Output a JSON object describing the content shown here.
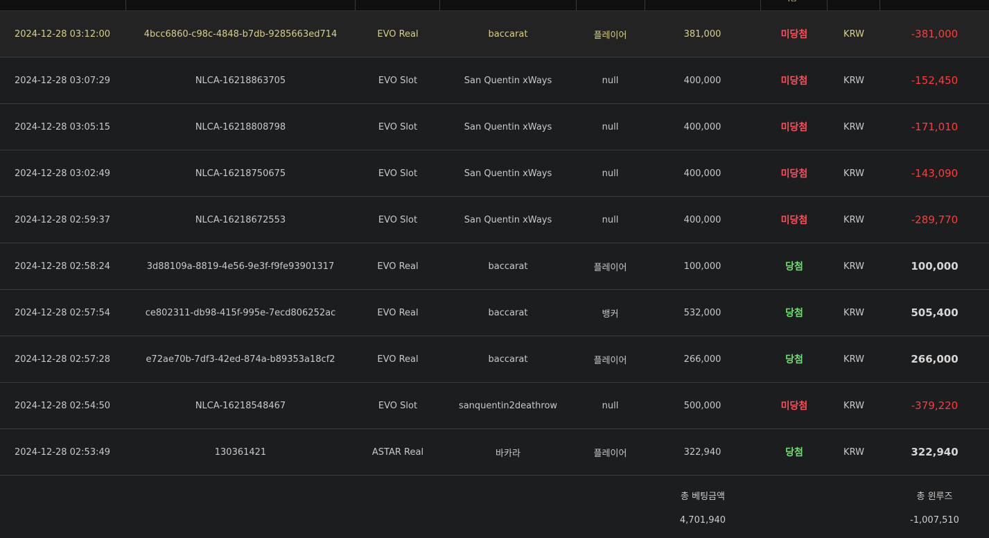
{
  "header": {
    "partial_label": "적중"
  },
  "rows": [
    {
      "date": "2024-12-28 03:12:00",
      "bet_id": "4bcc6860-c98c-4848-b7db-9285663ed714",
      "vendor": "EVO Real",
      "game": "baccarat",
      "pick": "플레이어",
      "bet": "381,000",
      "result": "미당첨",
      "currency": "KRW",
      "winloss": "-381,000",
      "status": "lose"
    },
    {
      "date": "2024-12-28 03:07:29",
      "bet_id": "NLCA-16218863705",
      "vendor": "EVO Slot",
      "game": "San Quentin xWays",
      "pick": "null",
      "bet": "400,000",
      "result": "미당첨",
      "currency": "KRW",
      "winloss": "-152,450",
      "status": "lose"
    },
    {
      "date": "2024-12-28 03:05:15",
      "bet_id": "NLCA-16218808798",
      "vendor": "EVO Slot",
      "game": "San Quentin xWays",
      "pick": "null",
      "bet": "400,000",
      "result": "미당첨",
      "currency": "KRW",
      "winloss": "-171,010",
      "status": "lose"
    },
    {
      "date": "2024-12-28 03:02:49",
      "bet_id": "NLCA-16218750675",
      "vendor": "EVO Slot",
      "game": "San Quentin xWays",
      "pick": "null",
      "bet": "400,000",
      "result": "미당첨",
      "currency": "KRW",
      "winloss": "-143,090",
      "status": "lose"
    },
    {
      "date": "2024-12-28 02:59:37",
      "bet_id": "NLCA-16218672553",
      "vendor": "EVO Slot",
      "game": "San Quentin xWays",
      "pick": "null",
      "bet": "400,000",
      "result": "미당첨",
      "currency": "KRW",
      "winloss": "-289,770",
      "status": "lose"
    },
    {
      "date": "2024-12-28 02:58:24",
      "bet_id": "3d88109a-8819-4e56-9e3f-f9fe93901317",
      "vendor": "EVO Real",
      "game": "baccarat",
      "pick": "플레이어",
      "bet": "100,000",
      "result": "당첨",
      "currency": "KRW",
      "winloss": "100,000",
      "status": "win"
    },
    {
      "date": "2024-12-28 02:57:54",
      "bet_id": "ce802311-db98-415f-995e-7ecd806252ac",
      "vendor": "EVO Real",
      "game": "baccarat",
      "pick": "뱅커",
      "bet": "532,000",
      "result": "당첨",
      "currency": "KRW",
      "winloss": "505,400",
      "status": "win"
    },
    {
      "date": "2024-12-28 02:57:28",
      "bet_id": "e72ae70b-7df3-42ed-874a-b89353a18cf2",
      "vendor": "EVO Real",
      "game": "baccarat",
      "pick": "플레이어",
      "bet": "266,000",
      "result": "당첨",
      "currency": "KRW",
      "winloss": "266,000",
      "status": "win"
    },
    {
      "date": "2024-12-28 02:54:50",
      "bet_id": "NLCA-16218548467",
      "vendor": "EVO Slot",
      "game": "sanquentin2deathrow",
      "pick": "null",
      "bet": "500,000",
      "result": "미당첨",
      "currency": "KRW",
      "winloss": "-379,220",
      "status": "lose"
    },
    {
      "date": "2024-12-28 02:53:49",
      "bet_id": "130361421",
      "vendor": "ASTAR Real",
      "game": "바카라",
      "pick": "플레이어",
      "bet": "322,940",
      "result": "당첨",
      "currency": "KRW",
      "winloss": "322,940",
      "status": "win"
    }
  ],
  "summary": {
    "total_bet_label": "총 베팅금액",
    "total_bet_value": "4,701,940",
    "total_winloss_label": "총 윈루즈",
    "total_winloss_value": "-1,007,510"
  },
  "colors": {
    "lose": "#ff4e58",
    "win": "#6ee06e",
    "highlight_text": "#d8cf8a"
  }
}
